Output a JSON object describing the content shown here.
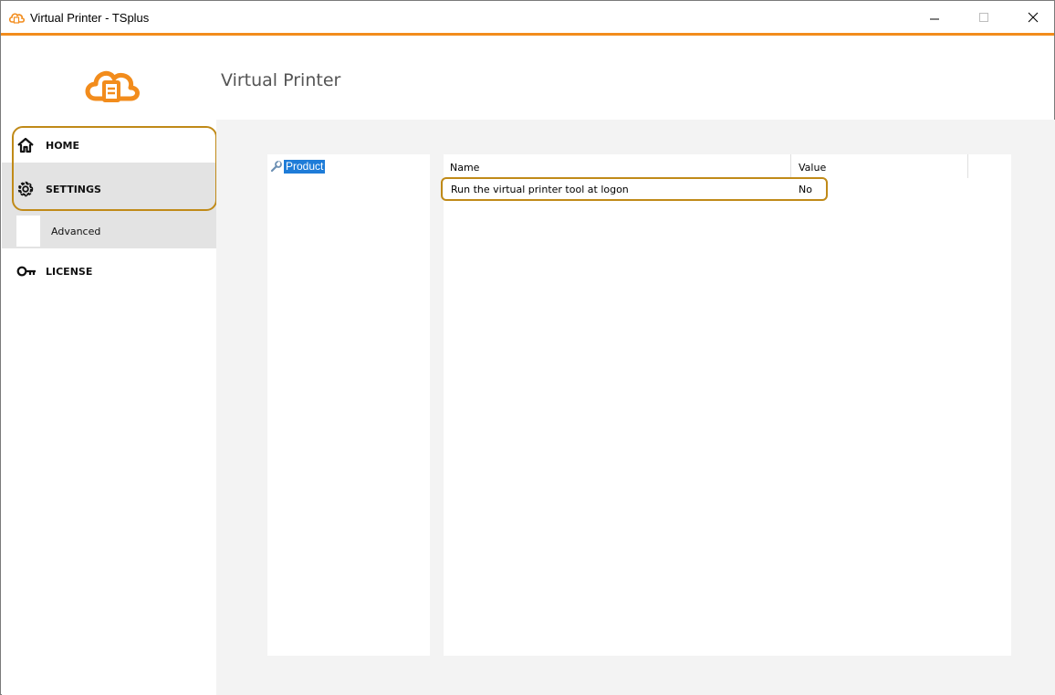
{
  "window": {
    "title": "Virtual Printer - TSplus",
    "accent_color": "#f28c1c",
    "highlight_color": "#c08a18"
  },
  "header": {
    "page_title": "Virtual Printer",
    "logo_icon": "cloud-printer-icon"
  },
  "sidebar": {
    "items": [
      {
        "label": "HOME",
        "icon": "home-icon"
      },
      {
        "label": "SETTINGS",
        "icon": "gear-icon",
        "selected": true,
        "subitems": [
          {
            "label": "Advanced"
          }
        ]
      },
      {
        "label": "LICENSE",
        "icon": "key-icon"
      }
    ]
  },
  "tree": {
    "items": [
      {
        "label": "Product",
        "icon": "wrench-icon",
        "selected": true
      }
    ]
  },
  "grid": {
    "columns": [
      "Name",
      "Value"
    ],
    "rows": [
      {
        "name": "Run the virtual printer tool at logon",
        "value": "No"
      }
    ]
  }
}
